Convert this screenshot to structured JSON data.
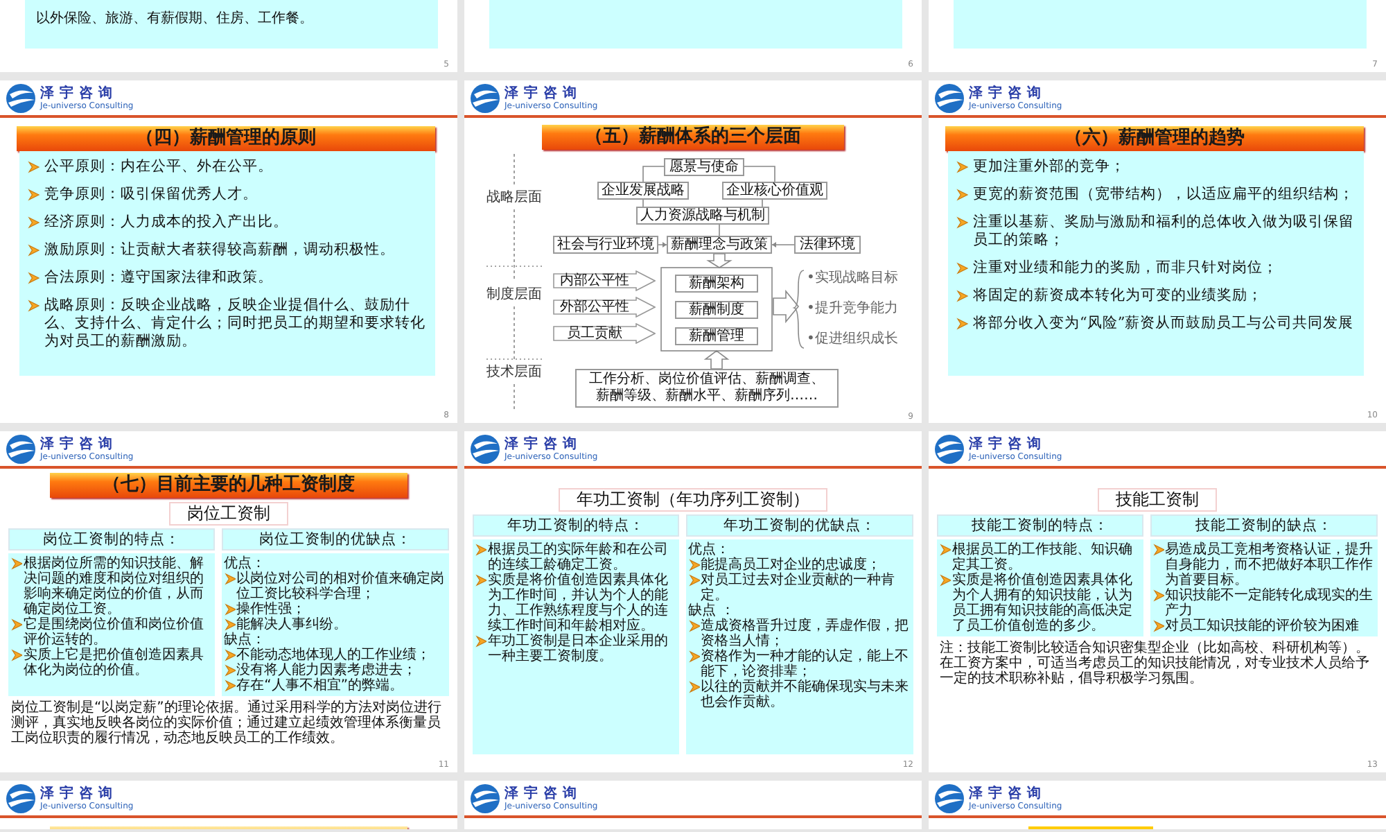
{
  "slides": [
    {
      "kind": "partial-top",
      "number": "5",
      "lines": [
        "以外保险、旅游、有薪假期、住房、工作餐。"
      ]
    },
    {
      "kind": "partial-top",
      "number": "6"
    },
    {
      "kind": "partial-top",
      "number": "7"
    },
    {
      "kind": "bullets",
      "number": "8",
      "header": {
        "name": "泽宇咨询",
        "tagline": "Je-universo Consulting"
      },
      "banner": {
        "kind": "wide",
        "title": "（四）薪酬管理的原则"
      },
      "bullets": [
        "公平原则：内在公平、外在公平。",
        "竞争原则：吸引保留优秀人才。",
        "经济原则：人力成本的投入产出比。",
        "激励原则：让贡献大者获得较高薪酬，调动积极性。",
        "合法原则：遵守国家法律和政策。",
        "战略原则：反映企业战略，反映企业提倡什么、鼓励什么、支持什么、肯定什么；同时把员工的期望和要求转化为对员工的薪酬激励。"
      ]
    },
    {
      "kind": "diagram",
      "number": "9",
      "header": {
        "name": "泽宇咨询",
        "tagline": "Je-universo Consulting"
      },
      "banner": {
        "kind": "narrow",
        "title": "（五）薪酬体系的三个层面"
      },
      "levels": [
        "战略层面",
        "制度层面",
        "技术层面"
      ],
      "nodes": [
        {
          "kind": "box",
          "text": "愿景与使命"
        },
        {
          "kind": "box",
          "text": "企业发展战略"
        },
        {
          "kind": "box",
          "text": "企业核心价值观"
        },
        {
          "kind": "box",
          "text": "人力资源战略与机制"
        },
        {
          "kind": "box",
          "text": "社会与行业环境"
        },
        {
          "kind": "box",
          "text": "薪酬理念与政策"
        },
        {
          "kind": "box",
          "text": "法律环境"
        },
        {
          "kind": "arrow-box",
          "text": "内部公平性"
        },
        {
          "kind": "arrow-box",
          "text": "外部公平性"
        },
        {
          "kind": "arrow-box",
          "text": "员工贡献"
        },
        {
          "kind": "box",
          "text": "薪酬架构"
        },
        {
          "kind": "box",
          "text": "薪酬制度"
        },
        {
          "kind": "box",
          "text": "薪酬管理"
        },
        {
          "kind": "outcome",
          "text": "•实现战略目标"
        },
        {
          "kind": "outcome",
          "text": "•提升竞争能力"
        },
        {
          "kind": "outcome",
          "text": "•促进组织成长"
        },
        {
          "kind": "base",
          "lines": [
            "工作分析、岗位价值评估、薪酬调查、",
            "薪酬等级、薪酬水平、薪酬序列……"
          ]
        }
      ]
    },
    {
      "kind": "bullets",
      "number": "10",
      "header": {
        "name": "泽宇咨询",
        "tagline": "Je-universo Consulting"
      },
      "banner": {
        "kind": "wide",
        "title": "（六）薪酬管理的趋势"
      },
      "bullets": [
        "更加注重外部的竞争；",
        "更宽的薪资范围（宽带结构），以适应扁平的组织结构；",
        "注重以基薪、奖励与激励和福利的总体收入做为吸引保留员工的策略；",
        "注重对业绩和能力的奖励，而非只针对岗位；",
        "将固定的薪资成本转化为可变的业绩奖励；",
        "将部分收入变为“风险”薪资从而鼓励员工与公司共同发展"
      ]
    },
    {
      "kind": "compare",
      "number": "11",
      "header": {
        "name": "泽宇咨询",
        "tagline": "Je-universo Consulting"
      },
      "banner": {
        "kind": "medium",
        "title": "（七）目前主要的几种工资制度"
      },
      "subtitle": "岗位工资制",
      "columns": [
        {
          "heading": "岗位工资制的特点：",
          "items": [
            {
              "kind": "bullet",
              "text": "根据岗位所需的知识技能、解决问题的难度和岗位对组织的影响来确定岗位的价值，从而确定岗位工资。"
            },
            {
              "kind": "bullet",
              "text": "它是围绕岗位价值和岗位价值评价运转的。"
            },
            {
              "kind": "bullet",
              "text": "实质上它是把价值创造因素具体化为岗位的价值。"
            }
          ]
        },
        {
          "heading": "岗位工资制的优缺点：",
          "items": [
            {
              "kind": "label",
              "text": "优点："
            },
            {
              "kind": "bullet",
              "text": "以岗位对公司的相对价值来确定岗位工资比较科学合理；"
            },
            {
              "kind": "bullet",
              "text": "操作性强；"
            },
            {
              "kind": "bullet",
              "text": "能解决人事纠纷。"
            },
            {
              "kind": "label",
              "text": "缺点："
            },
            {
              "kind": "bullet",
              "text": "不能动态地体现人的工作业绩；"
            },
            {
              "kind": "bullet",
              "text": "没有将人能力因素考虑进去；"
            },
            {
              "kind": "bullet",
              "text": "存在“人事不相宜”的弊端。"
            }
          ]
        }
      ],
      "note": "岗位工资制是“以岗定薪”的理论依据。通过采用科学的方法对岗位进行测评，真实地反映各岗位的实际价值；通过建立起绩效管理体系衡量员工岗位职责的履行情况，动态地反映员工的工作绩效。"
    },
    {
      "kind": "compare",
      "number": "12",
      "header": {
        "name": "泽宇咨询",
        "tagline": "Je-universo Consulting"
      },
      "subtitle": "年功工资制（年功序列工资制）",
      "columns": [
        {
          "heading": "年功工资制的特点：",
          "items": [
            {
              "kind": "bullet",
              "text": "根据员工的实际年龄和在公司的连续工龄确定工资。"
            },
            {
              "kind": "bullet",
              "text": "实质是将价值创造因素具体化为工作时间，并认为个人的能力、工作熟练程度与个人的连续工作时间和年龄相对应。"
            },
            {
              "kind": "bullet",
              "text": "年功工资制是日本企业采用的一种主要工资制度。"
            }
          ]
        },
        {
          "heading": "年功工资制的优缺点：",
          "items": [
            {
              "kind": "label",
              "text": "优点："
            },
            {
              "kind": "bullet",
              "text": "能提高员工对企业的忠诚度；"
            },
            {
              "kind": "bullet",
              "text": "对员工过去对企业贡献的一种肯定。"
            },
            {
              "kind": "label",
              "text": "缺点 ："
            },
            {
              "kind": "bullet",
              "text": "造成资格晋升过度，弄虚作假，把资格当人情；"
            },
            {
              "kind": "bullet",
              "text": "资格作为一种才能的认定，能上不能下，论资排辈；"
            },
            {
              "kind": "bullet",
              "text": "以往的贡献并不能确保现实与未来也会作贡献。"
            }
          ]
        }
      ]
    },
    {
      "kind": "compare",
      "number": "13",
      "header": {
        "name": "泽宇咨询",
        "tagline": "Je-universo Consulting"
      },
      "subtitle": "技能工资制",
      "columns": [
        {
          "heading": "技能工资制的特点：",
          "items": [
            {
              "kind": "bullet",
              "text": "根据员工的工作技能、知识确定其工资。"
            },
            {
              "kind": "bullet",
              "text": "实质是将价值创造因素具体化为个人拥有的知识技能，认为员工拥有知识技能的高低决定了员工价值创造的多少。"
            }
          ]
        },
        {
          "heading": "技能工资制的缺点：",
          "items": [
            {
              "kind": "bullet",
              "text": "易造成员工竞相考资格认证，提升自身能力，而不把做好本职工作作为首要目标。"
            },
            {
              "kind": "bullet",
              "text": "知识技能不一定能转化成现实的生产力"
            },
            {
              "kind": "bullet",
              "text": "对员工知识技能的评价较为困难"
            }
          ]
        }
      ],
      "note": "注：技能工资制比较适合知识密集型企业（比如高校、科研机构等）。在工资方案中，可适当考虑员工的知识技能情况，对专业技术人员给予一定的技术职称补贴，倡导积极学习氛围。"
    },
    {
      "kind": "partial-bottom",
      "header": {
        "name": "泽宇咨询",
        "tagline": "Je-universo Consulting"
      },
      "banner": {
        "kind": "medium"
      }
    },
    {
      "kind": "partial-bottom",
      "header": {
        "name": "泽宇咨询",
        "tagline": "Je-universo Consulting"
      }
    },
    {
      "kind": "partial-bottom",
      "header": {
        "name": "泽宇咨询",
        "tagline": "Je-universo Consulting"
      },
      "banner": {
        "kind": "small"
      }
    }
  ]
}
